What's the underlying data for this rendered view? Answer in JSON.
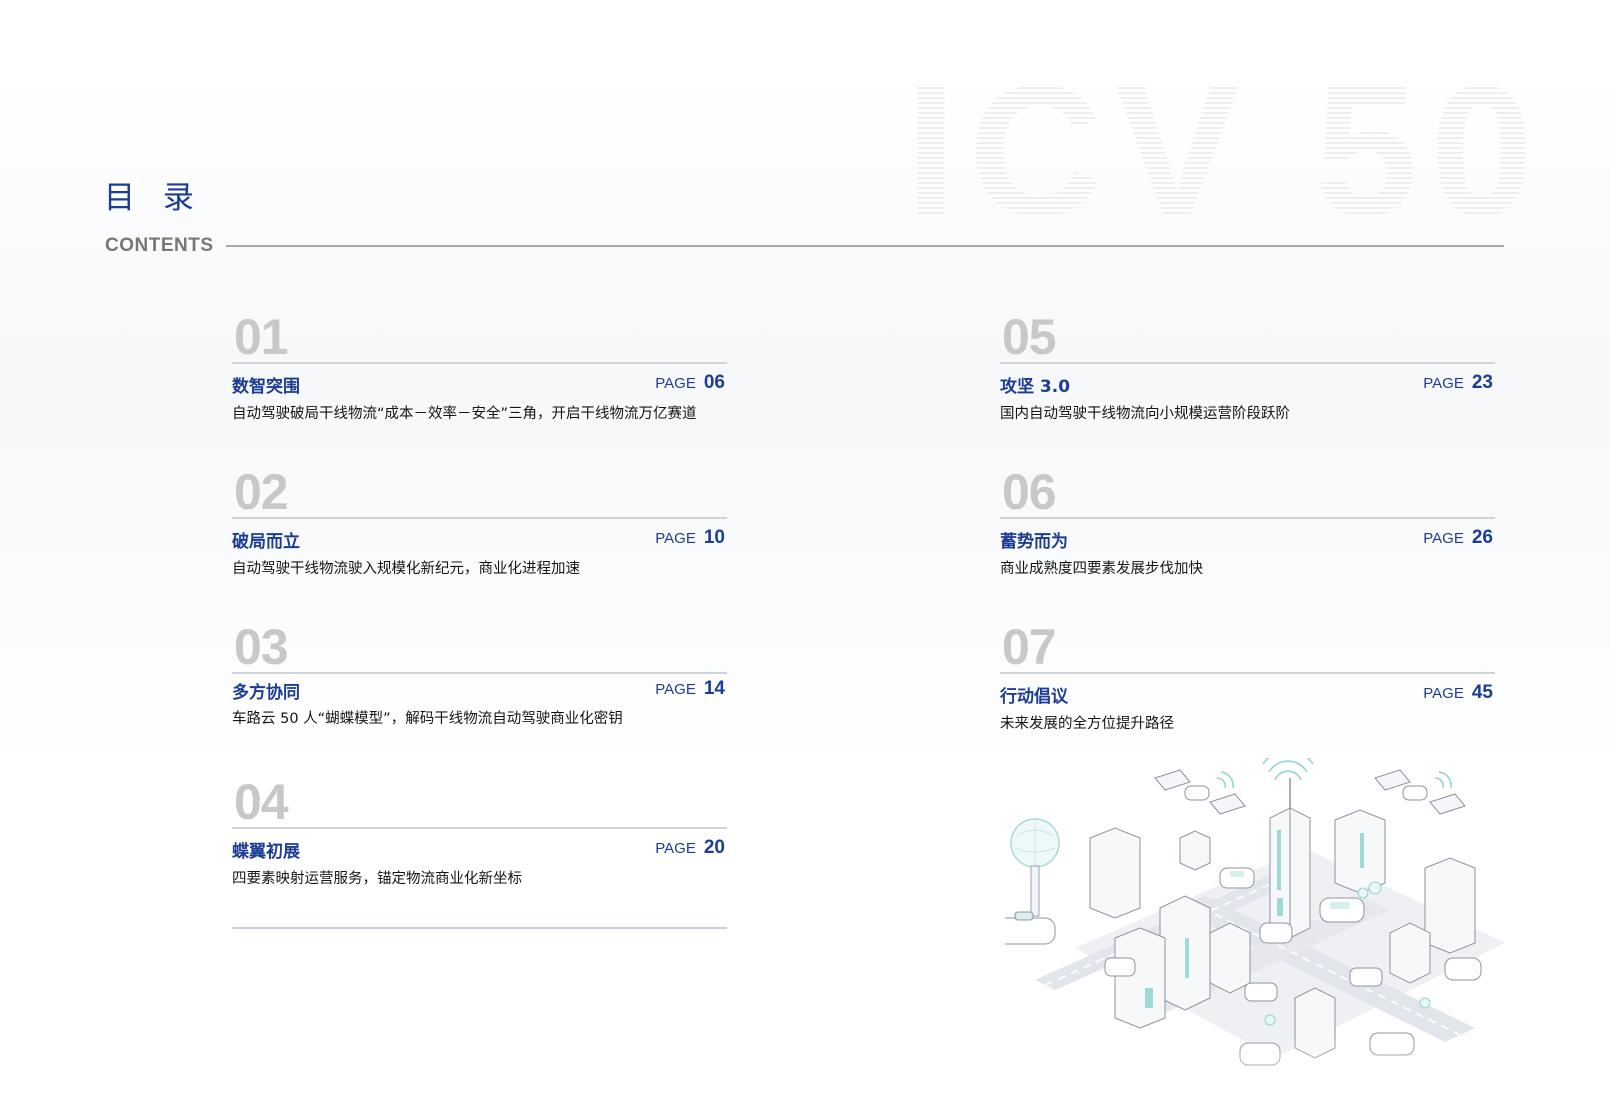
{
  "watermark": "ICV 50",
  "header": {
    "title": "目 录",
    "subtitle": "CONTENTS"
  },
  "entries": [
    {
      "num": "01",
      "title": "数智突围",
      "page_label": "PAGE",
      "page": "06",
      "desc": "自动驾驶破局干线物流“成本－效率－安全”三角，开启干线物流万亿赛道"
    },
    {
      "num": "02",
      "title": "破局而立",
      "page_label": "PAGE",
      "page": "10",
      "desc": "自动驾驶干线物流驶入规模化新纪元，商业化进程加速"
    },
    {
      "num": "03",
      "title": "多方协同",
      "page_label": "PAGE",
      "page": "14",
      "desc": "车路云 50 人“蝴蝶模型”，解码干线物流自动驾驶商业化密钥"
    },
    {
      "num": "04",
      "title": "蝶翼初展",
      "page_label": "PAGE",
      "page": "20",
      "desc": "四要素映射运营服务，锚定物流商业化新坐标"
    },
    {
      "num": "05",
      "title": "攻坚 3.0",
      "page_label": "PAGE",
      "page": "23",
      "desc": "国内自动驾驶干线物流向小规模运营阶段跃阶"
    },
    {
      "num": "06",
      "title": "蓄势而为",
      "page_label": "PAGE",
      "page": "26",
      "desc": "商业成熟度四要素发展步伐加快"
    },
    {
      "num": "07",
      "title": "行动倡议",
      "page_label": "PAGE",
      "page": "45",
      "desc": "未来发展的全方位提升路径"
    }
  ],
  "illustration": {
    "icon": "smart-city-illustration-icon"
  }
}
